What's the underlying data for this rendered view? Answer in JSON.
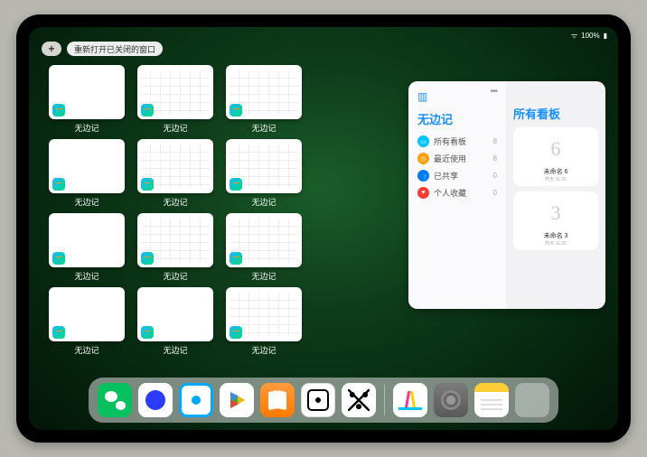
{
  "status": {
    "battery": "100%"
  },
  "toolbar": {
    "plus": "+",
    "reopen_label": "重新打开已关闭的窗口"
  },
  "app_switcher": {
    "thumb_label": "无边记",
    "rows": [
      [
        {
          "cal": false
        },
        {
          "cal": true
        },
        {
          "cal": true
        }
      ],
      [
        {
          "cal": false
        },
        {
          "cal": true
        },
        {
          "cal": true
        }
      ],
      [
        {
          "cal": false
        },
        {
          "cal": true
        },
        {
          "cal": true
        }
      ],
      [
        {
          "cal": false
        },
        {
          "cal": false
        },
        {
          "cal": true
        }
      ]
    ]
  },
  "panel": {
    "left_title": "无边记",
    "more": "•••",
    "items": [
      {
        "icon_bg": "#00c4ff",
        "glyph": "▭",
        "label": "所有看板",
        "count": "8"
      },
      {
        "icon_bg": "#ff9f0a",
        "glyph": "◷",
        "label": "最近使用",
        "count": "8"
      },
      {
        "icon_bg": "#007aff",
        "glyph": "👥",
        "label": "已共享",
        "count": "0"
      },
      {
        "icon_bg": "#ff3b30",
        "glyph": "♥",
        "label": "个人收藏",
        "count": "0"
      }
    ],
    "right_title": "所有看板",
    "boards": [
      {
        "sketch": "6",
        "label": "未命名 6",
        "sub": "昨天 11:25"
      },
      {
        "sketch": "3",
        "label": "未命名 3",
        "sub": "昨天 11:25"
      }
    ]
  },
  "dock": {
    "apps": [
      {
        "name": "wechat-icon",
        "cls": "wechat"
      },
      {
        "name": "quark-icon",
        "cls": "quark1"
      },
      {
        "name": "browser-icon",
        "cls": "quark2"
      },
      {
        "name": "play-icon",
        "cls": "play"
      },
      {
        "name": "books-icon",
        "cls": "books"
      },
      {
        "name": "game-icon",
        "cls": "dice"
      },
      {
        "name": "okx-icon",
        "cls": "nodes"
      }
    ],
    "recent": [
      {
        "name": "freeform-icon",
        "cls": "freeform"
      },
      {
        "name": "settings-icon",
        "cls": "settings"
      },
      {
        "name": "notes-icon",
        "cls": "notes"
      },
      {
        "name": "app-folder-icon",
        "cls": "folder"
      }
    ]
  }
}
